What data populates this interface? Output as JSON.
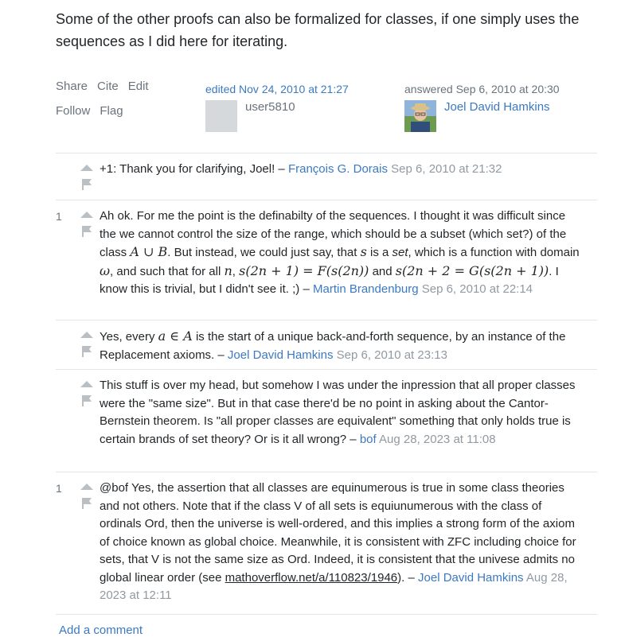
{
  "intro": "Some of the other proofs can also be formalized for classes, if one simply uses the sequences as I did here for iterating.",
  "post_menu": {
    "share": "Share",
    "cite": "Cite",
    "edit": "Edit",
    "follow": "Follow",
    "flag": "Flag"
  },
  "edited": {
    "action": "edited Nov 24, 2010 at 21:27",
    "user": "user5810"
  },
  "answered": {
    "action": "answered Sep 6, 2010 at 20:30",
    "user": "Joel David Hamkins"
  },
  "comments": [
    {
      "score": "",
      "text": "+1: Thank you for clarifying, Joel! –",
      "user": "François G. Dorais",
      "date": "Sep 6, 2010 at 21:32"
    },
    {
      "score": "1",
      "user": "Martin Brandenburg",
      "date": "Sep 6, 2010 at 22:14",
      "p1": "Ah ok. For me the point is the definabilty of the sequences. I thought it was difficult since the we cannot control the size of the range, which should be a subset (which set?) of the class",
      "m1": "A ∪ B",
      "p2": ". But instead, we could just say, that",
      "m2": "s",
      "p3": "is a",
      "p3i": "set",
      "p4": ", which is a function with domain",
      "m3": "ω",
      "p5": ", and such that for all",
      "m4": "n",
      "p6": ",",
      "m5": "s(2n + 1) = F(s(2n))",
      "p7": "and",
      "m6": "s(2n + 2 = G(s(2n + 1))",
      "p8": ". I know this is trivial, but I didn't see it. ;) –"
    },
    {
      "score": "",
      "user": "Joel David Hamkins",
      "date": "Sep 6, 2010 at 23:13",
      "p1": "Yes, every",
      "m1": "a ∈ A",
      "p2": "is the start of a unique back-and-forth sequence, by an instance of the Replacement axioms. –"
    },
    {
      "score": "",
      "text": "This stuff is over my head, but somehow I was under the inpression that all proper classes were the \"same size\". But in that case there'd be no point in asking about the Cantor-Bernstein theorem. Is \"all proper classes are equivalent\" something that only holds true is certain brands of set theory? Or is it all wrong? –",
      "user": "bof",
      "date": "Aug 28, 2023 at 11:08"
    },
    {
      "score": "1",
      "text": "@bof Yes, the assertion that all classes are equinumerous is true in some class theories and not others. Note that if the class V of all sets is equiunumerous with the class of ordinals Ord, then the universe is well-ordered, and this implies a strong form of the axiom of choice known as global choice. Meanwhile, it is consistent with ZFC including choice for sets, that V is not the same size as Ord. Indeed, it is consistent that the univese admits no global linear order (see",
      "link": "mathoverflow.net/a/110823/1946",
      "tail": "). –",
      "user": "Joel David Hamkins",
      "date": "Aug 28, 2023 at 12:11"
    }
  ],
  "add_comment": "Add a comment",
  "colors": {
    "link": "#3b79c3",
    "muted": "#6a737c",
    "date": "#9199a1",
    "border": "#e3e6e8",
    "arrow": "#babfc4"
  }
}
